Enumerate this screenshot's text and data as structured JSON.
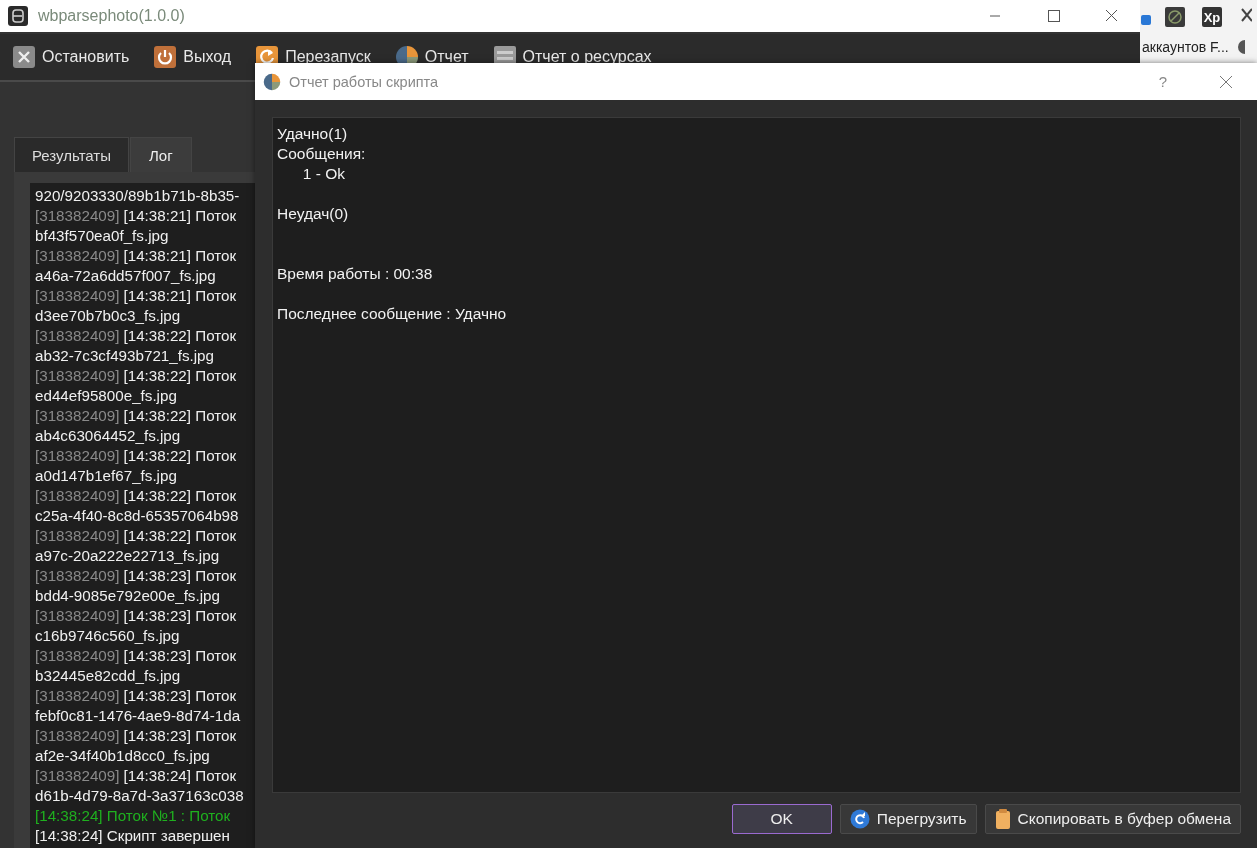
{
  "main_window": {
    "title": "wbparsephoto(1.0.0)"
  },
  "toolbar": [
    {
      "kind": "stop",
      "label": "Остановить"
    },
    {
      "kind": "exit",
      "label": "Выход"
    },
    {
      "kind": "restart",
      "label": "Перезапуск"
    },
    {
      "kind": "report",
      "label": "Отчет"
    },
    {
      "kind": "resources",
      "label": "Отчет о ресурсах"
    }
  ],
  "tabs": [
    {
      "label": "Результаты",
      "selected": false
    },
    {
      "label": "Лог",
      "selected": true
    }
  ],
  "log": [
    {
      "kind": "plain",
      "text": "920/9203330/89b1b71b-8b35-"
    },
    {
      "kind": "entry",
      "id": "[318382409]",
      "text": "[14:38:21] Поток"
    },
    {
      "kind": "plain",
      "text": "bf43f570ea0f_fs.jpg"
    },
    {
      "kind": "entry",
      "id": "[318382409]",
      "text": "[14:38:21] Поток"
    },
    {
      "kind": "plain",
      "text": "a46a-72a6dd57f007_fs.jpg"
    },
    {
      "kind": "entry",
      "id": "[318382409]",
      "text": "[14:38:21] Поток"
    },
    {
      "kind": "plain",
      "text": "d3ee70b7b0c3_fs.jpg"
    },
    {
      "kind": "entry",
      "id": "[318382409]",
      "text": "[14:38:22] Поток"
    },
    {
      "kind": "plain",
      "text": "ab32-7c3cf493b721_fs.jpg"
    },
    {
      "kind": "entry",
      "id": "[318382409]",
      "text": "[14:38:22] Поток"
    },
    {
      "kind": "plain",
      "text": "ed44ef95800e_fs.jpg"
    },
    {
      "kind": "entry",
      "id": "[318382409]",
      "text": "[14:38:22] Поток"
    },
    {
      "kind": "plain",
      "text": "ab4c63064452_fs.jpg"
    },
    {
      "kind": "entry",
      "id": "[318382409]",
      "text": "[14:38:22] Поток"
    },
    {
      "kind": "plain",
      "text": "a0d147b1ef67_fs.jpg"
    },
    {
      "kind": "entry",
      "id": "[318382409]",
      "text": "[14:38:22] Поток"
    },
    {
      "kind": "plain",
      "text": "c25a-4f40-8c8d-65357064b98"
    },
    {
      "kind": "entry",
      "id": "[318382409]",
      "text": "[14:38:22] Поток"
    },
    {
      "kind": "plain",
      "text": "a97c-20a222e22713_fs.jpg"
    },
    {
      "kind": "entry",
      "id": "[318382409]",
      "text": "[14:38:23] Поток"
    },
    {
      "kind": "plain",
      "text": "bdd4-9085e792e00e_fs.jpg"
    },
    {
      "kind": "entry",
      "id": "[318382409]",
      "text": "[14:38:23] Поток"
    },
    {
      "kind": "plain",
      "text": "c16b9746c560_fs.jpg"
    },
    {
      "kind": "entry",
      "id": "[318382409]",
      "text": "[14:38:23] Поток"
    },
    {
      "kind": "plain",
      "text": "b32445e82cdd_fs.jpg"
    },
    {
      "kind": "entry",
      "id": "[318382409]",
      "text": "[14:38:23] Поток"
    },
    {
      "kind": "plain",
      "text": "febf0c81-1476-4ae9-8d74-1da"
    },
    {
      "kind": "entry",
      "id": "[318382409]",
      "text": "[14:38:23] Поток"
    },
    {
      "kind": "plain",
      "text": "af2e-34f40b1d8cc0_fs.jpg"
    },
    {
      "kind": "entry",
      "id": "[318382409]",
      "text": "[14:38:24] Поток"
    },
    {
      "kind": "plain",
      "text": "d61b-4d79-8a7d-3a37163c038"
    },
    {
      "kind": "success",
      "text": "[14:38:24] Поток №1 : Поток"
    },
    {
      "kind": "plain",
      "text": "[14:38:24] Скрипт завершен"
    }
  ],
  "background_window": {
    "label": "аккаунтов F...",
    "tile": "Xp"
  },
  "dialog": {
    "title": "Отчет работы скрипта",
    "help": "?",
    "report_text": "Удачно(1)\nСообщения:\n      1 - Ok\n\nНеудач(0)\n\n\nВремя работы : 00:38\n\nПоследнее сообщение : Удачно",
    "buttons": [
      {
        "kind": "ok",
        "label": "OK",
        "focused": true
      },
      {
        "kind": "reload",
        "label": "Перегрузить",
        "focused": false
      },
      {
        "kind": "copy",
        "label": "Скопировать в буфер обмена",
        "focused": false
      }
    ]
  }
}
